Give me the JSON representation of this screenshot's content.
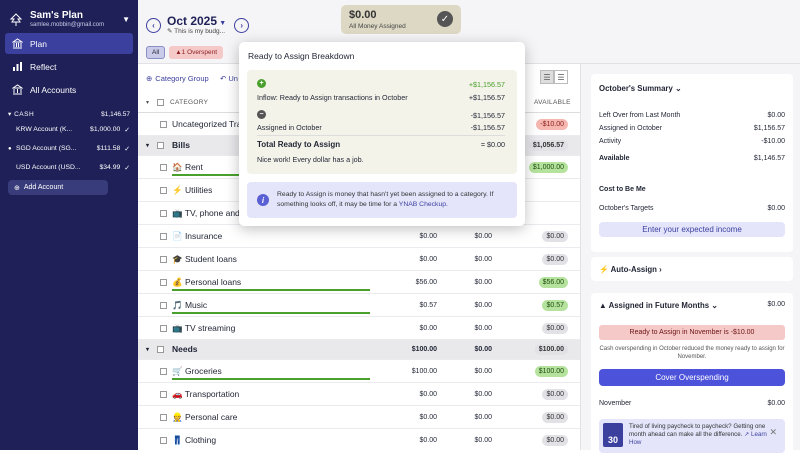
{
  "sidebar": {
    "plan_name": "Sam's Plan",
    "plan_email": "samlee.mobbin@gmail.com",
    "nav": [
      {
        "label": "Plan",
        "icon": "bank-icon"
      },
      {
        "label": "Reflect",
        "icon": "chart-icon"
      },
      {
        "label": "All Accounts",
        "icon": "accounts-icon"
      }
    ],
    "cash_label": "CASH",
    "cash_total": "$1,146.57",
    "accounts": [
      {
        "name": "KRW Account (K...",
        "balance": "$1,000.00"
      },
      {
        "name": "SGD Account (SG...",
        "balance": "$111.58"
      },
      {
        "name": "USD Account (USD...",
        "balance": "$34.99"
      }
    ],
    "add_account": "Add Account"
  },
  "header": {
    "month": "Oct 2025",
    "month_note": "This is my budg...",
    "rta_amount": "$0.00",
    "rta_label": "All Money Assigned",
    "filter_all": "All",
    "filter_overspent": "1 Overspent"
  },
  "toolbar": {
    "category_group": "Category Group",
    "undo": "Un"
  },
  "table": {
    "header_category": "CATEGORY",
    "header_available": "AVAILABLE",
    "rows": [
      {
        "kind": "sub",
        "name": "Uncategorized Tra",
        "a": "",
        "b": "",
        "c": "-$10.00",
        "pill": "red",
        "bar": false
      },
      {
        "kind": "group",
        "name": "Bills",
        "a": "",
        "b": "",
        "c": "$1,056.57",
        "pill": "gray",
        "bar": false
      },
      {
        "kind": "sub",
        "name": "🏠 Rent",
        "a": "",
        "b": "",
        "c": "$1,000.00",
        "pill": "green",
        "bar": true
      },
      {
        "kind": "sub",
        "name": "⚡ Utilities",
        "a": "",
        "b": "",
        "c": "",
        "pill": "",
        "bar": false
      },
      {
        "kind": "sub",
        "name": "📺 TV, phone and",
        "a": "",
        "b": "",
        "c": "",
        "pill": "",
        "bar": false
      },
      {
        "kind": "sub",
        "name": "📄 Insurance",
        "a": "$0.00",
        "b": "$0.00",
        "c": "$0.00",
        "pill": "gray",
        "bar": false
      },
      {
        "kind": "sub",
        "name": "🎓 Student loans",
        "a": "$0.00",
        "b": "$0.00",
        "c": "$0.00",
        "pill": "gray",
        "bar": false
      },
      {
        "kind": "sub",
        "name": "💰 Personal loans",
        "a": "$56.00",
        "b": "$0.00",
        "c": "$56.00",
        "pill": "green",
        "bar": true
      },
      {
        "kind": "sub",
        "name": "🎵 Music",
        "a": "$0.57",
        "b": "$0.00",
        "c": "$0.57",
        "pill": "green",
        "bar": true
      },
      {
        "kind": "sub",
        "name": "📺 TV streaming",
        "a": "$0.00",
        "b": "$0.00",
        "c": "$0.00",
        "pill": "gray",
        "bar": false
      },
      {
        "kind": "group",
        "name": "Needs",
        "a": "$100.00",
        "b": "$0.00",
        "c": "$100.00",
        "pill": "gray",
        "bar": false
      },
      {
        "kind": "sub",
        "name": "🛒 Groceries",
        "a": "$100.00",
        "b": "$0.00",
        "c": "$100.00",
        "pill": "green",
        "bar": true
      },
      {
        "kind": "sub",
        "name": "🚗 Transportation",
        "a": "$0.00",
        "b": "$0.00",
        "c": "$0.00",
        "pill": "gray",
        "bar": false
      },
      {
        "kind": "sub",
        "name": "👷 Personal care",
        "a": "$0.00",
        "b": "$0.00",
        "c": "$0.00",
        "pill": "gray",
        "bar": false
      },
      {
        "kind": "sub",
        "name": "👖 Clothing",
        "a": "$0.00",
        "b": "$0.00",
        "c": "$0.00",
        "pill": "gray",
        "bar": false
      }
    ]
  },
  "popover": {
    "title": "Ready to Assign Breakdown",
    "inflow_amount_top": "+$1,156.57",
    "inflow_label": "Inflow: Ready to Assign transactions in October",
    "inflow_amount": "+$1,156.57",
    "assigned_amount_top": "-$1,156.57",
    "assigned_label": "Assigned in October",
    "assigned_amount": "-$1,156.57",
    "total_label": "Total Ready to Assign",
    "total_amount": "= $0.00",
    "nice_work": "Nice work! Every dollar has a job.",
    "info_text": "Ready to Assign is money that hasn't yet been assigned to a category. If something looks off, it may be time for a ",
    "info_link": "YNAB Checkup."
  },
  "right": {
    "summary_title": "October's Summary",
    "left_over_label": "Left Over from Last Month",
    "left_over": "$0.00",
    "assigned_label": "Assigned in October",
    "assigned": "$1,156.57",
    "activity_label": "Activity",
    "activity": "-$10.00",
    "available_label": "Available",
    "available": "$1,146.57",
    "cost_label": "Cost to Be Me",
    "targets_label": "October's Targets",
    "targets": "$0.00",
    "expected_income_btn": "Enter your expected income",
    "auto_assign": "Auto-Assign",
    "future_title": "Assigned in Future Months",
    "future_amount": "$0.00",
    "future_band": "Ready to Assign in November is -$10.00",
    "future_note": "Cash overspending in October reduced the money ready to assign for November.",
    "cover_btn": "Cover Overspending",
    "november_label": "November",
    "november": "$0.00",
    "promo_day": "30",
    "promo_text": "Tired of living paycheck to paycheck? Getting one month ahead can make all the difference.",
    "promo_link": "Learn How"
  },
  "colors": {
    "sidebar": "#1e2057",
    "accent": "#3b3f9e",
    "green": "#4aa02c",
    "red": "#f5b7b0"
  }
}
